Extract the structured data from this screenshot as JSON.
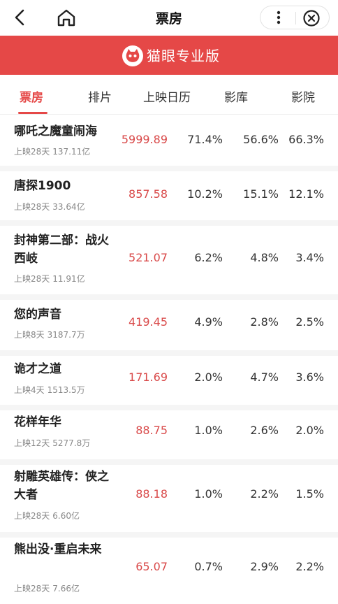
{
  "nav": {
    "title": "票房"
  },
  "brand": {
    "name": "猫眼专业版",
    "color": "#e54847"
  },
  "tabs": [
    {
      "label": "票房",
      "active": true
    },
    {
      "label": "排片",
      "active": false
    },
    {
      "label": "上映日历",
      "active": false
    },
    {
      "label": "影库",
      "active": false
    },
    {
      "label": "影院",
      "active": false
    }
  ],
  "movies": [
    {
      "name": "哪吒之魔童闹海",
      "days": "上映28天",
      "total": "137.11亿",
      "box": "5999.89",
      "p1": "71.4%",
      "p2": "56.6%",
      "p3": "66.3%"
    },
    {
      "name": "唐探1900",
      "days": "上映28天",
      "total": "33.64亿",
      "box": "857.58",
      "p1": "10.2%",
      "p2": "15.1%",
      "p3": "12.1%"
    },
    {
      "name": "封神第二部：战火西岐",
      "days": "上映28天",
      "total": "11.91亿",
      "box": "521.07",
      "p1": "6.2%",
      "p2": "4.8%",
      "p3": "3.4%"
    },
    {
      "name": "您的声音",
      "days": "上映8天",
      "total": "3187.7万",
      "box": "419.45",
      "p1": "4.9%",
      "p2": "2.8%",
      "p3": "2.5%"
    },
    {
      "name": "诡才之道",
      "days": "上映4天",
      "total": "1513.5万",
      "box": "171.69",
      "p1": "2.0%",
      "p2": "4.7%",
      "p3": "3.6%"
    },
    {
      "name": "花样年华",
      "days": "上映12天",
      "total": "5277.8万",
      "box": "88.75",
      "p1": "1.0%",
      "p2": "2.6%",
      "p3": "2.0%"
    },
    {
      "name": "射雕英雄传：侠之大者",
      "days": "上映28天",
      "total": "6.60亿",
      "box": "88.18",
      "p1": "1.0%",
      "p2": "2.2%",
      "p3": "1.5%"
    },
    {
      "name": "熊出没·重启未来",
      "days": "上映28天",
      "total": "7.66亿",
      "box": "65.07",
      "p1": "0.7%",
      "p2": "2.9%",
      "p3": "2.2%"
    }
  ]
}
